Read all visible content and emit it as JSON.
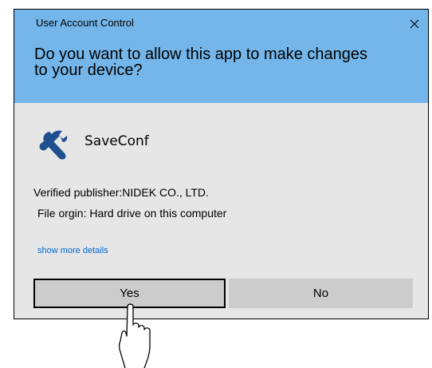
{
  "dialog": {
    "title": "User Account Control",
    "close_glyph": "×",
    "question": "Do you want to allow this app to make changes to your device?",
    "app_icon": "wrench-icon",
    "app_name": "SaveConf",
    "publisher": "Verified publisher:NIDEK CO., LTD.",
    "origin": "File orgin: Hard drive on this computer",
    "more_details_link": "show more details",
    "yes_label": "Yes",
    "no_label": "No"
  },
  "colors": {
    "header_bg": "#74b6ea",
    "body_bg": "#e6e6e6",
    "button_bg": "#cccccc",
    "link": "#0066cc",
    "icon_blue": "#1f4f8f"
  },
  "pointer": {
    "icon": "hand-pointer-icon"
  }
}
